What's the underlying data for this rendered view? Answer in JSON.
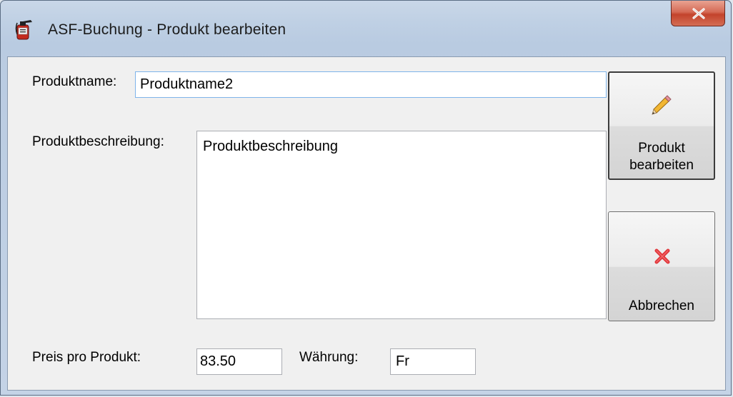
{
  "window": {
    "title": "ASF-Buchung - Produkt bearbeiten",
    "app_icon": "fire-extinguisher-icon",
    "close_icon": "close-icon"
  },
  "form": {
    "name_label": "Produktname:",
    "name_value": "Produktname2",
    "description_label": "Produktbeschreibung:",
    "description_value": "Produktbeschreibung",
    "price_label": "Preis pro Produkt:",
    "price_value": "83.50",
    "currency_label": "Währung:",
    "currency_value": "Fr"
  },
  "buttons": {
    "edit_line1": "Produkt",
    "edit_line2": "bearbeiten",
    "edit_icon": "pencil-icon",
    "cancel_label": "Abbrechen",
    "cancel_icon": "red-x-icon"
  },
  "colors": {
    "close_button": "#c94b34",
    "field_focus_border": "#7eb4ea",
    "cancel_icon": "#e0363a",
    "pencil_body": "#f2b632"
  }
}
